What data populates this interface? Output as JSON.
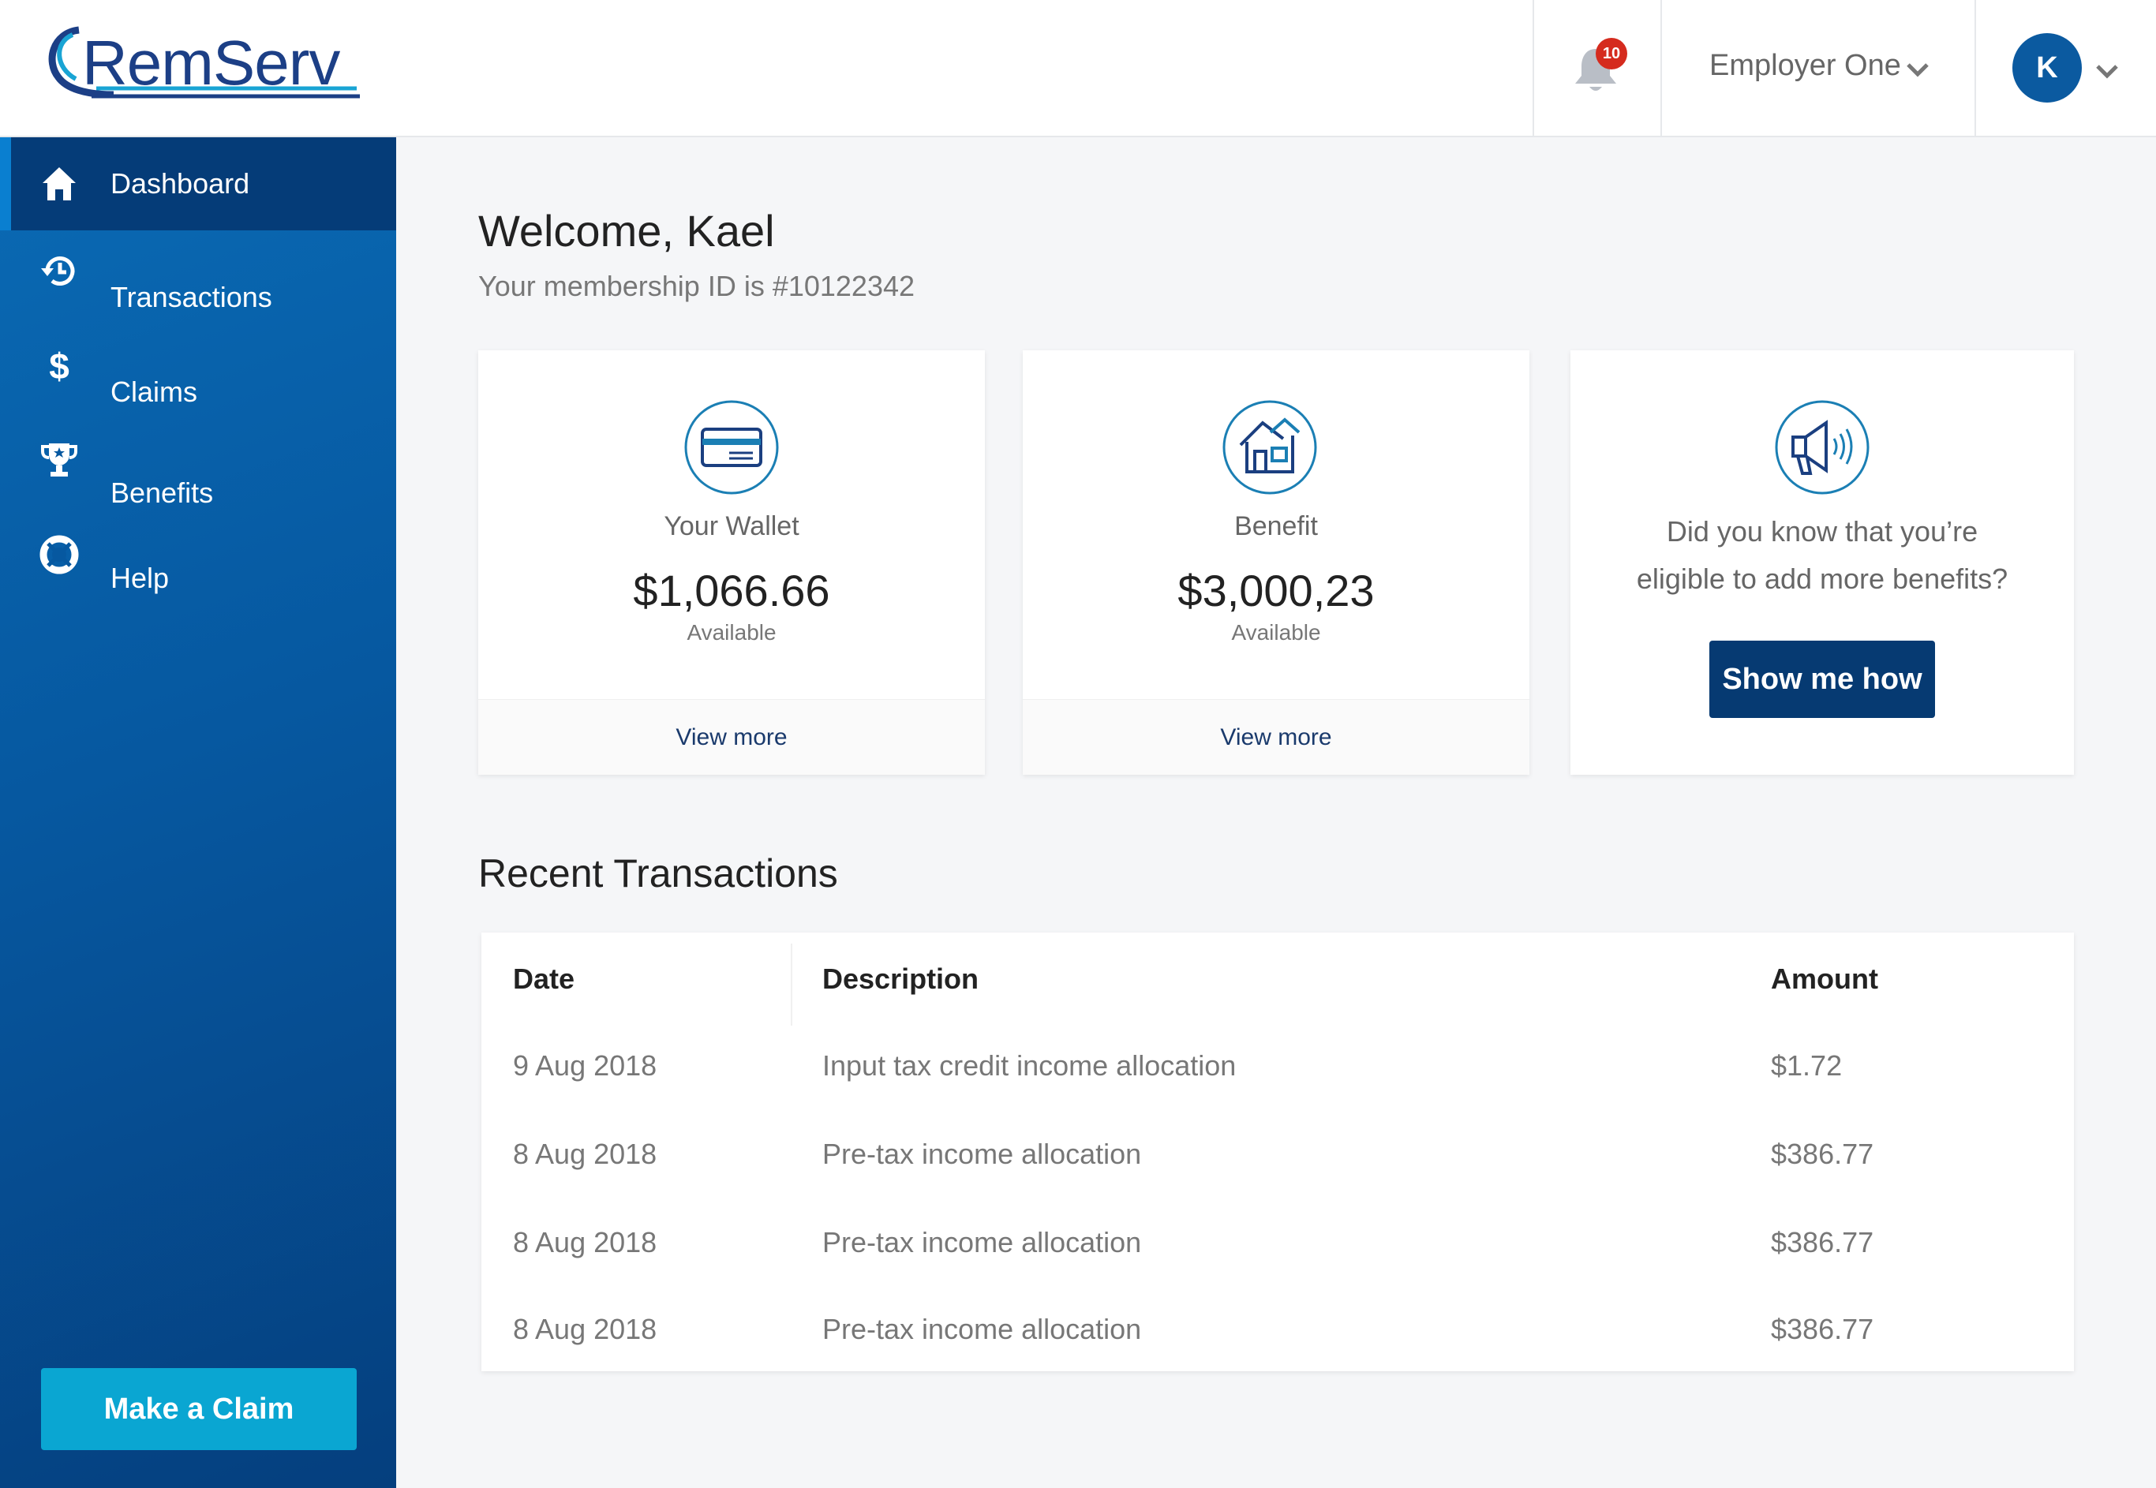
{
  "header": {
    "logo_text": "RemServ",
    "notification_count": "10",
    "employer": "Employer One",
    "avatar_initial": "K"
  },
  "sidebar": {
    "items": [
      {
        "label": "Dashboard",
        "icon": "home-icon"
      },
      {
        "label": "Transactions",
        "icon": "history-icon"
      },
      {
        "label": "Claims",
        "icon": "dollar-icon"
      },
      {
        "label": "Benefits",
        "icon": "trophy-icon"
      },
      {
        "label": "Help",
        "icon": "lifebuoy-icon"
      }
    ],
    "claim_button": "Make a Claim"
  },
  "main": {
    "welcome": "Welcome, Kael",
    "membership": "Your membership ID is #10122342",
    "cards": [
      {
        "title": "Your Wallet",
        "amount": "$1,066.66",
        "sub": "Available",
        "footer": "View more",
        "icon": "credit-card-icon"
      },
      {
        "title": "Benefit",
        "amount": "$3,000,23",
        "sub": "Available",
        "footer": "View more",
        "icon": "house-icon"
      }
    ],
    "promo": {
      "line1": "Did you know that you’re",
      "line2": "eligible to add more benefits?",
      "button": "Show me how",
      "icon": "megaphone-icon"
    },
    "recent_title": "Recent Transactions",
    "table": {
      "headers": {
        "date": "Date",
        "description": "Description",
        "amount": "Amount"
      },
      "rows": [
        {
          "date": "9 Aug 2018",
          "description": "Input tax credit income allocation",
          "amount": "$1.72"
        },
        {
          "date": "8 Aug 2018",
          "description": "Pre-tax income allocation",
          "amount": "$386.77"
        },
        {
          "date": "8 Aug 2018",
          "description": "Pre-tax income allocation",
          "amount": "$386.77"
        },
        {
          "date": "8 Aug 2018",
          "description": "Pre-tax income allocation",
          "amount": "$386.77"
        }
      ]
    }
  },
  "colors": {
    "brand_blue": "#0658a0",
    "accent_cyan": "#0aa6d2",
    "dark_navy": "#063a72",
    "badge_red": "#d52b1e"
  }
}
